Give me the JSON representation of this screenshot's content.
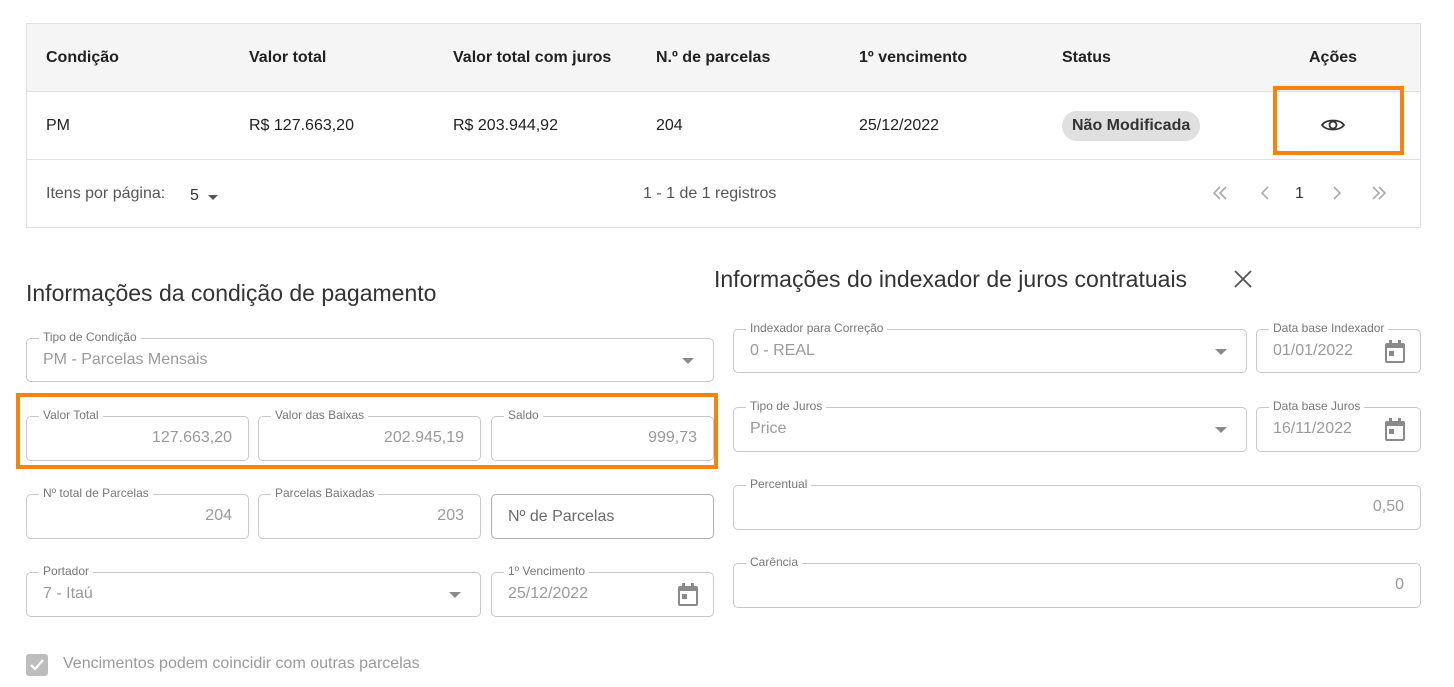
{
  "table": {
    "headers": {
      "condicao": "Condição",
      "valor_total": "Valor total",
      "valor_total_juros": "Valor total com juros",
      "num_parcelas": "N.º de parcelas",
      "primeiro_vencimento": "1º vencimento",
      "status": "Status",
      "acoes": "Ações"
    },
    "rows": [
      {
        "condicao": "PM",
        "valor_total": "R$ 127.663,20",
        "valor_total_juros": "R$ 203.944,92",
        "num_parcelas": "204",
        "primeiro_vencimento": "25/12/2022",
        "status": "Não Modificada",
        "action_icon": "eye-icon"
      }
    ],
    "footer": {
      "items_per_page_label": "Itens por página:",
      "items_per_page_value": "5",
      "range_text": "1 - 1 de 1 registros",
      "current_page": "1"
    }
  },
  "payment_info": {
    "title": "Informações da condição de pagamento",
    "tipo_condicao": {
      "label": "Tipo de Condição",
      "value": "PM - Parcelas Mensais"
    },
    "valor_total": {
      "label": "Valor Total",
      "value": "127.663,20"
    },
    "valor_baixas": {
      "label": "Valor das Baixas",
      "value": "202.945,19"
    },
    "saldo": {
      "label": "Saldo",
      "value": "999,73"
    },
    "total_parcelas": {
      "label": "Nº total de Parcelas",
      "value": "204"
    },
    "parcelas_baixadas": {
      "label": "Parcelas Baixadas",
      "value": "203"
    },
    "num_parcelas": {
      "placeholder": "Nº de Parcelas"
    },
    "portador": {
      "label": "Portador",
      "value": "7 - Itaú"
    },
    "primeiro_vencimento": {
      "label": "1º Vencimento",
      "value": "25/12/2022"
    },
    "checkbox_label": "Vencimentos podem coincidir com outras parcelas",
    "checkbox_checked": true
  },
  "indexer_info": {
    "title": "Informações do indexador de juros contratuais",
    "indexador": {
      "label": "Indexador para Correção",
      "value": "0 - REAL"
    },
    "data_base_indexador": {
      "label": "Data base Indexador",
      "value": "01/01/2022"
    },
    "tipo_juros": {
      "label": "Tipo de Juros",
      "value": "Price"
    },
    "data_base_juros": {
      "label": "Data base Juros",
      "value": "16/11/2022"
    },
    "percentual": {
      "label": "Percentual",
      "value": "0,50"
    },
    "carencia": {
      "label": "Carência",
      "value": "0"
    }
  },
  "colors": {
    "highlight": "#f7830e",
    "chip_bg": "#e0e0e0",
    "header_bg": "#f5f5f5"
  }
}
